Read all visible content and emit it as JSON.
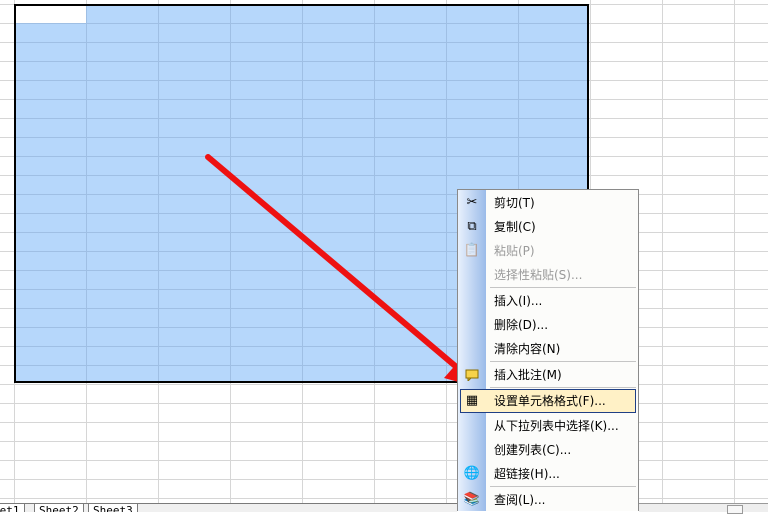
{
  "colors": {
    "selection_fill": "#b6d7fb",
    "menu_highlight": "#fff1c6",
    "arrow": "#ee1111"
  },
  "context_menu": {
    "items": [
      {
        "label": "剪切(T)",
        "icon": "scissors-icon",
        "glyph": "✂"
      },
      {
        "label": "复制(C)",
        "icon": "copy-icon",
        "glyph": "⧉"
      },
      {
        "label": "粘贴(P)",
        "icon": "paste-icon",
        "glyph": "📋"
      },
      {
        "label": "选择性粘贴(S)...",
        "icon": "",
        "glyph": ""
      },
      {
        "label": "插入(I)...",
        "icon": "",
        "glyph": ""
      },
      {
        "label": "删除(D)...",
        "icon": "",
        "glyph": ""
      },
      {
        "label": "清除内容(N)",
        "icon": "",
        "glyph": ""
      },
      {
        "label": "插入批注(M)",
        "icon": "comment-icon",
        "glyph": ""
      },
      {
        "label": "设置单元格格式(F)...",
        "icon": "format-cells-icon",
        "glyph": "▦"
      },
      {
        "label": "从下拉列表中选择(K)...",
        "icon": "",
        "glyph": ""
      },
      {
        "label": "创建列表(C)...",
        "icon": "",
        "glyph": ""
      },
      {
        "label": "超链接(H)...",
        "icon": "hyperlink-icon",
        "glyph": "🌐"
      },
      {
        "label": "查阅(L)...",
        "icon": "research-icon",
        "glyph": "📚"
      }
    ]
  },
  "sheet_tabs": [
    "eet1",
    "Sheet2",
    "Sheet3"
  ]
}
